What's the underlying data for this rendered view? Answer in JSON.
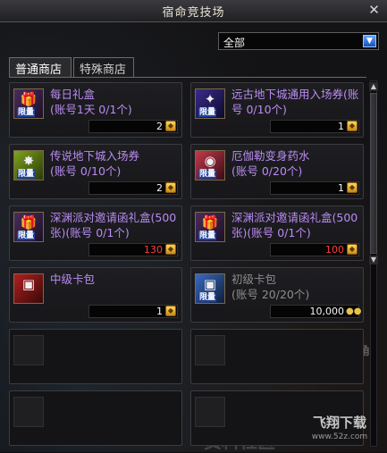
{
  "window": {
    "title": "宿命竞技场",
    "close": "✕"
  },
  "filter": {
    "value": "全部",
    "arrow": "▼"
  },
  "tabs": [
    {
      "label": "普通商店",
      "active": true
    },
    {
      "label": "特殊商店",
      "active": false
    }
  ],
  "items": [
    {
      "name": "每日礼盒\n(账号1天 0/1个)",
      "price": "2",
      "badge": "限量",
      "currency": "coin",
      "icon": "gift-box-icon",
      "glyph": "🎁"
    },
    {
      "name": "远古地下城通用入场券(账号 0/10个)",
      "price": "1",
      "badge": "限量",
      "currency": "coin",
      "icon": "ancient-dungeon-ticket-icon",
      "glyph": "✦"
    },
    {
      "name": "传说地下城入场券\n(账号 0/10个)",
      "price": "2",
      "badge": "限量",
      "currency": "coin",
      "icon": "legend-dungeon-ticket-icon",
      "glyph": "✸"
    },
    {
      "name": "厄伽勒变身药水\n(账号 0/20个)",
      "price": "1",
      "badge": "限量",
      "currency": "coin",
      "icon": "transform-potion-icon",
      "glyph": "◉"
    },
    {
      "name": "深渊派对邀请函礼盒(500张)(账号 0/1个)",
      "price": "130",
      "price_red": true,
      "badge": "限量",
      "currency": "coin",
      "icon": "abyss-invitation-box-icon",
      "glyph": "🎁"
    },
    {
      "name": "深渊派对邀请函礼盒(500张)(账号 0/1个)",
      "price": "100",
      "price_red": true,
      "badge": "限量",
      "currency": "coin",
      "icon": "abyss-invitation-box-icon",
      "glyph": "🎁"
    },
    {
      "name": "中级卡包",
      "price": "1",
      "badge": "",
      "currency": "coin",
      "icon": "card-pack-icon",
      "glyph": "▣"
    },
    {
      "name": "初级卡包\n(账号 20/20个)",
      "price": "10,000",
      "badge": "限量",
      "currency": "gold",
      "icon": "basic-card-pack-icon",
      "glyph": "▣",
      "disabled": true
    }
  ],
  "watermark": {
    "logo": "飞翔下载",
    "url": "www.52z.com"
  },
  "background_text": {
    "a": "17173",
    "b": "资料社区",
    "c": "王角"
  },
  "colors": {
    "item_name": "#b98bf0",
    "price_red": "#ff3d3d",
    "badge_blue": "#1c3f9e"
  }
}
